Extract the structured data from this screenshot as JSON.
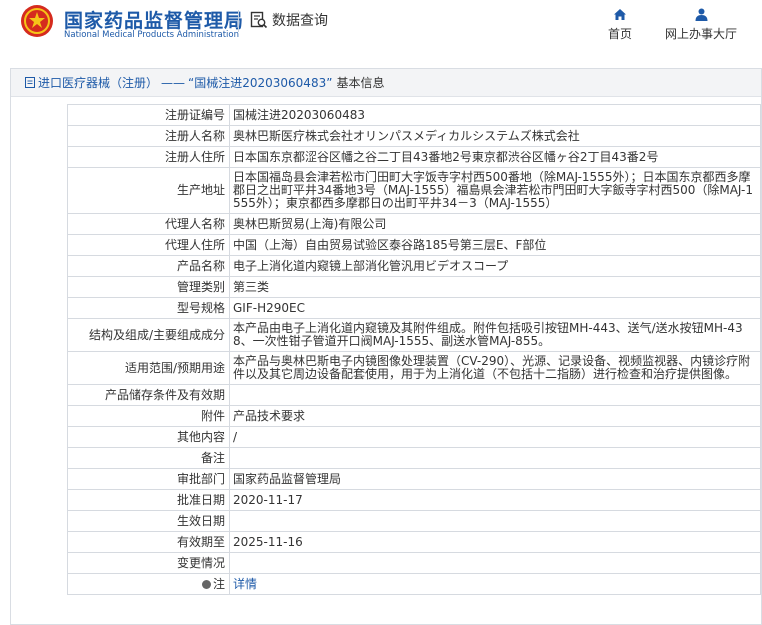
{
  "header": {
    "brand_cn": "国家药品监督管理局",
    "brand_en": "National Medical Products Administration",
    "query_label": "数据查询",
    "nav": [
      {
        "label": "首页",
        "icon": "home-icon"
      },
      {
        "label": "网上办事大厅",
        "icon": "user-icon"
      }
    ],
    "brand_color": "#1e5aa8"
  },
  "breadcrumb": {
    "link": "进口医疗器械（注册）",
    "sep": "——",
    "title": "“国械注进20203060483”",
    "suffix": "基本信息"
  },
  "rows": [
    {
      "key": "注册证编号",
      "value": "国械注进20203060483"
    },
    {
      "key": "注册人名称",
      "value": "奥林巴斯医疗株式会社オリンパスメディカルシステムズ株式会社"
    },
    {
      "key": "注册人住所",
      "value": "日本国东京都涩谷区幡之谷二丁目43番地2号東京都渋谷区幡ヶ谷2丁目43番2号"
    },
    {
      "key": "生产地址",
      "value": "日本国福岛县会津若松市门田町大字饭寺字村西500番地（除MAJ-1555外）；日本国东京都西多摩郡日之出町平井34番地3号（MAJ-1555）福島県会津若松市門田町大字飯寺字村西500（除MAJ-1555外）；東京都西多摩郡日の出町平井34－3（MAJ-1555）"
    },
    {
      "key": "代理人名称",
      "value": "奥林巴斯贸易(上海)有限公司"
    },
    {
      "key": "代理人住所",
      "value": "中国（上海）自由贸易试验区泰谷路185号第三层E、F部位"
    },
    {
      "key": "产品名称",
      "value": "电子上消化道内窥镜上部消化管汎用ビデオスコープ"
    },
    {
      "key": "管理类别",
      "value": "第三类"
    },
    {
      "key": "型号规格",
      "value": "GIF-H290EC"
    },
    {
      "key": "结构及组成/主要组成成分",
      "value": "本产品由电子上消化道内窥镜及其附件组成。附件包括吸引按钮MH-443、送气/送水按钮MH-438、一次性钳子管道开口阀MAJ-1555、副送水管MAJ-855。"
    },
    {
      "key": "适用范围/预期用途",
      "value": "本产品与奥林巴斯电子内镜图像处理装置（CV-290）、光源、记录设备、视频监视器、内镜诊疗附件以及其它周边设备配套使用，用于为上消化道（不包括十二指肠）进行检查和治疗提供图像。"
    },
    {
      "key": "产品储存条件及有效期",
      "value": ""
    },
    {
      "key": "附件",
      "value": "产品技术要求"
    },
    {
      "key": "其他内容",
      "value": "/"
    },
    {
      "key": "备注",
      "value": ""
    },
    {
      "key": "审批部门",
      "value": "国家药品监督管理局"
    },
    {
      "key": "批准日期",
      "value": "2020-11-17"
    },
    {
      "key": "生效日期",
      "value": ""
    },
    {
      "key": "有效期至",
      "value": "2025-11-16"
    },
    {
      "key": "变更情况",
      "value": ""
    },
    {
      "key": "注",
      "value": "详情"
    }
  ]
}
